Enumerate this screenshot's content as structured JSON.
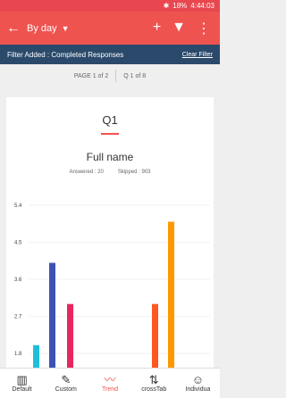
{
  "status": {
    "bluetooth": "✱",
    "battery": "18%",
    "time": "4:44:03"
  },
  "toolbar": {
    "back_icon": "arrow-left",
    "title": "By day",
    "caret": "▼",
    "add_icon": "plus",
    "filter_icon": "filter",
    "menu_icon": "more-vertical"
  },
  "filter": {
    "text": "Filter Added : Completed Responses",
    "clear_label": "Clear Filter"
  },
  "pager": {
    "page_text": "PAGE 1 of 2",
    "question_text": "Q 1 of 8"
  },
  "question": {
    "id": "Q1",
    "name": "Full name",
    "answered": "Answered : 20",
    "skipped": "Skipped : 903"
  },
  "chart_data": {
    "type": "bar",
    "y_ticks": [
      "5.4",
      "4.5",
      "3.6",
      "2.7",
      "1.8"
    ],
    "ylim": [
      0,
      5.4
    ],
    "bars": [
      {
        "value": 2.0,
        "color": "#1ec0d8"
      },
      {
        "value": 4.0,
        "color": "#3f51b5"
      },
      {
        "value": 3.0,
        "color": "#e8275e"
      },
      {
        "value": 3.0,
        "color": "#ff5722"
      },
      {
        "value": 5.0,
        "color": "#ff9800"
      }
    ]
  },
  "nav": [
    {
      "label": "Default",
      "icon": "bar-chart-icon",
      "glyph": "▥",
      "active": false
    },
    {
      "label": "Custom",
      "icon": "pencil-icon",
      "glyph": "✎",
      "active": false
    },
    {
      "label": "Trend",
      "icon": "trend-icon",
      "glyph": "〰",
      "active": true
    },
    {
      "label": "crossTab",
      "icon": "crosstab-icon",
      "glyph": "⇅",
      "active": false
    },
    {
      "label": "Individua",
      "icon": "person-icon",
      "glyph": "☺",
      "active": false
    }
  ]
}
